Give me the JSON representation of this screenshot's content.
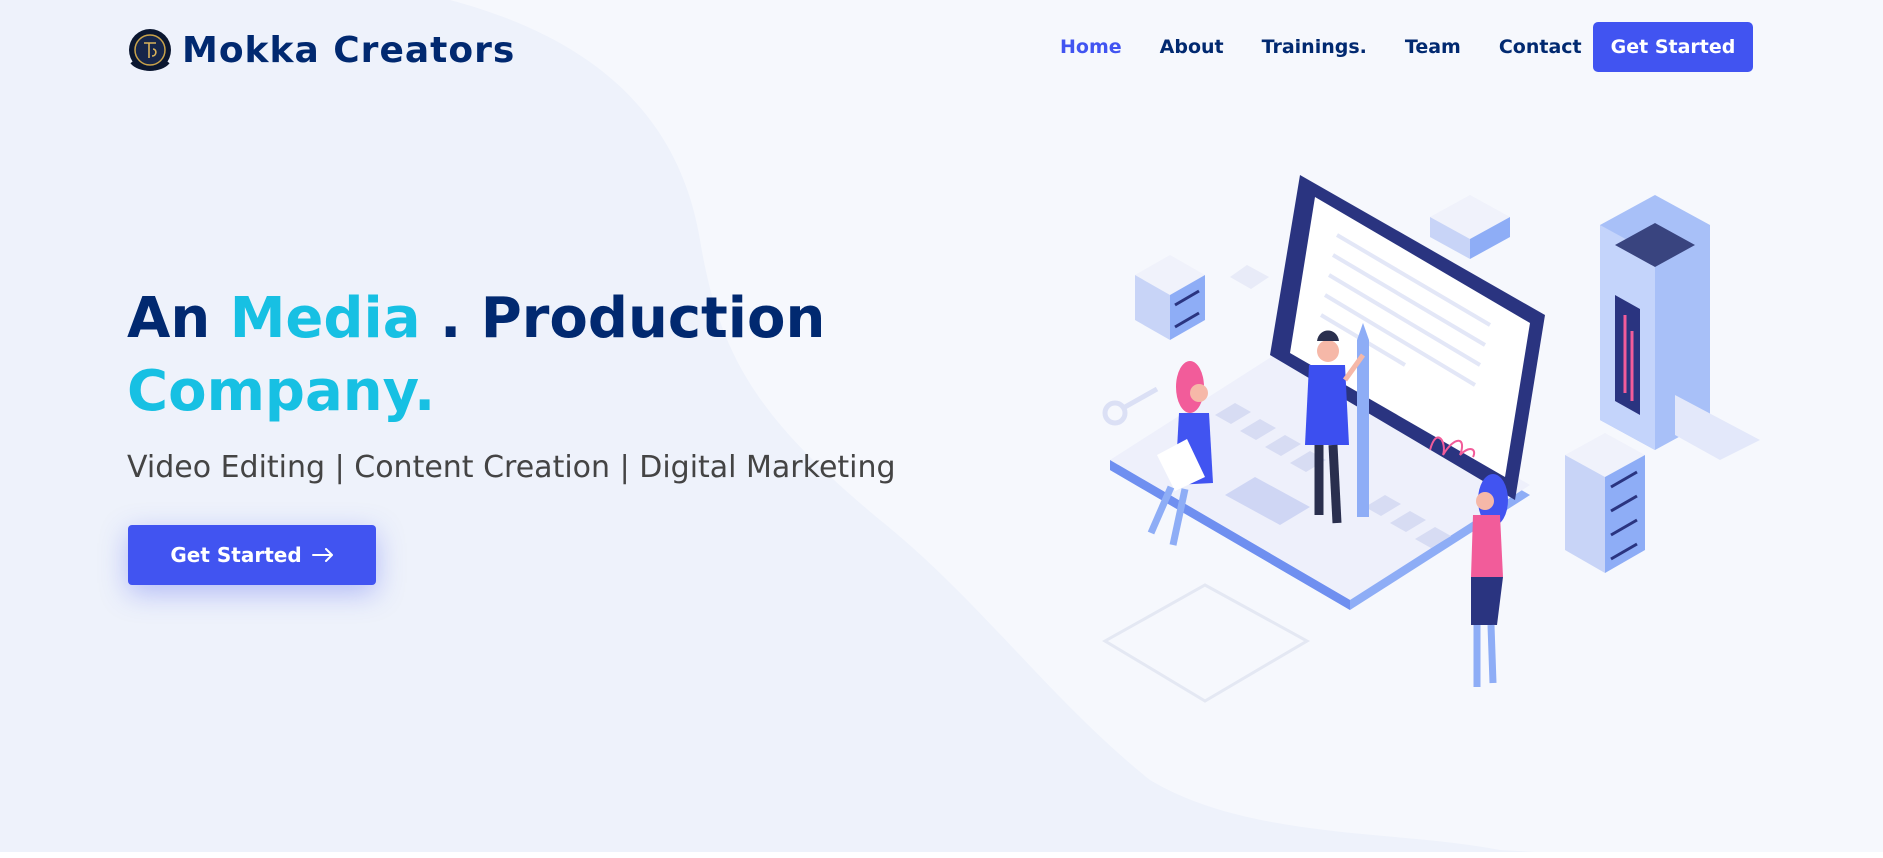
{
  "header": {
    "brand": "Mokka Creators",
    "logo_icon": "mokka-logo-icon",
    "nav": [
      {
        "label": "Home",
        "active": true
      },
      {
        "label": "About"
      },
      {
        "label": "Trainings."
      },
      {
        "label": "Team"
      },
      {
        "label": "Contact"
      }
    ],
    "cta_label": "Get Started"
  },
  "hero": {
    "title_part1": "An ",
    "title_accent1": "Media",
    "title_part2": " . Production",
    "title_accent2": "Company.",
    "subtitle": "Video Editing | Content Creation | Digital Marketing",
    "button_label": "Get Started",
    "button_icon": "arrow-right-icon",
    "illustration": "isometric-laptop-illustration"
  },
  "colors": {
    "primary": "#4154f1",
    "navy": "#012970",
    "accent": "#17c0e3",
    "background": "#f6f8fd"
  }
}
